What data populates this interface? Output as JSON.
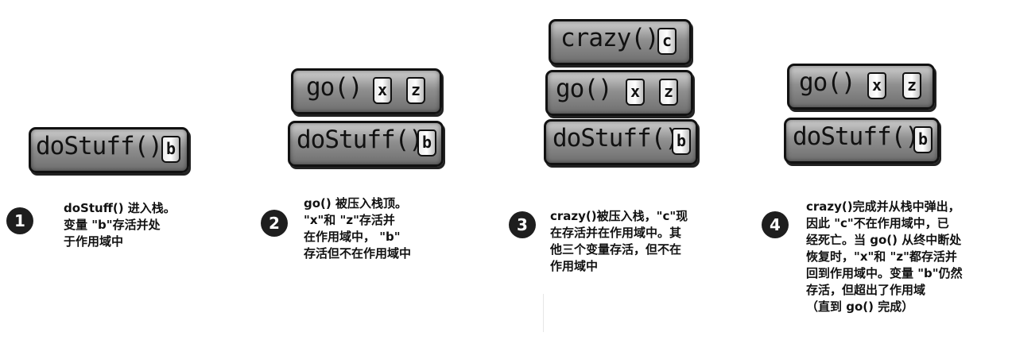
{
  "steps": [
    {
      "number": "1",
      "frames": [
        {
          "label": "doStuff()",
          "vars": [
            "b"
          ]
        }
      ],
      "caption": [
        "doStuff() 进入栈。",
        "变量 \"b\"存活并处",
        "于作用域中"
      ]
    },
    {
      "number": "2",
      "frames": [
        {
          "label": "go()",
          "vars": [
            "x",
            "z"
          ]
        },
        {
          "label": "doStuff()",
          "vars": [
            "b"
          ]
        }
      ],
      "caption": [
        "go() 被压入栈顶。",
        "\"x\"和 \"z\"存活并",
        "在作用域中， \"b\"",
        "存活但不在作用域中"
      ]
    },
    {
      "number": "3",
      "frames": [
        {
          "label": "crazy()",
          "vars": [
            "c"
          ]
        },
        {
          "label": "go()",
          "vars": [
            "x",
            "z"
          ]
        },
        {
          "label": "doStuff()",
          "vars": [
            "b"
          ]
        }
      ],
      "caption": [
        "crazy()被压入栈，\"c\"现",
        "在存活并在作用域中。其",
        "他三个变量存活，但不在",
        "作用域中"
      ]
    },
    {
      "number": "4",
      "frames": [
        {
          "label": "go()",
          "vars": [
            "x",
            "z"
          ]
        },
        {
          "label": "doStuff()",
          "vars": [
            "b"
          ]
        }
      ],
      "caption": [
        "crazy()完成并从栈中弹出，",
        "因此 \"c\"不在作用域中，已",
        "经死亡。当 go() 从终中断处",
        "恢复时，\"x\"和 \"z\"都存活并",
        "回到作用域中。变量 \"b\"仍然",
        "存活，但超出了作用域",
        "（直到 go() 完成）"
      ]
    }
  ]
}
